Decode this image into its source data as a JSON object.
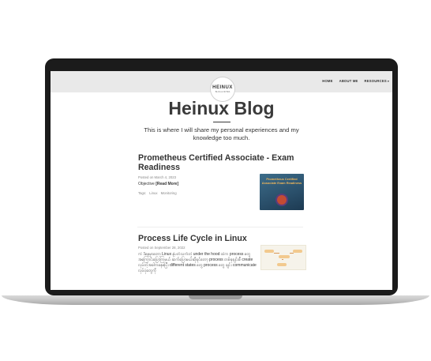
{
  "navbar": {
    "logo_title": "HEINUX",
    "logo_sub": "BLOG & NOTES",
    "links": [
      "HOME",
      "ABOUT ME",
      "RESOURCES"
    ]
  },
  "header": {
    "title": "Heinux Blog",
    "subtitle": "This is where I will share my personal experiences and my knowledge too much."
  },
  "posts": [
    {
      "title": "Prometheus Certified Associate - Exam Readiness",
      "meta": "Posted on March 4, 2023",
      "excerpt": "Objective ",
      "read_more": "[Read More]",
      "tags_label": "Tags:",
      "tags": [
        "Linux",
        "Monitoring"
      ],
      "thumb_text": "Prometheus Certified Associate Exam Readiness"
    },
    {
      "title": "Process Life Cycle in Linux",
      "meta": "Posted on September 28, 2022",
      "excerpt": "ကဲ ဒီနေ့မှာတော့ Linux နဲ့ပတ်သက်တဲ့ under the hood ထဲက process တွေအကြောင်းပြောကြမယ် ဆက်ပြောမယ်ဆိုရင်တော့ process တစ်ခုချင်းစီ create လုပ်တဲ့အခါကနေစပြီး different states တွေ process တွေ ချင်း communicate လုပ်ပုံတွေကို"
    }
  ]
}
